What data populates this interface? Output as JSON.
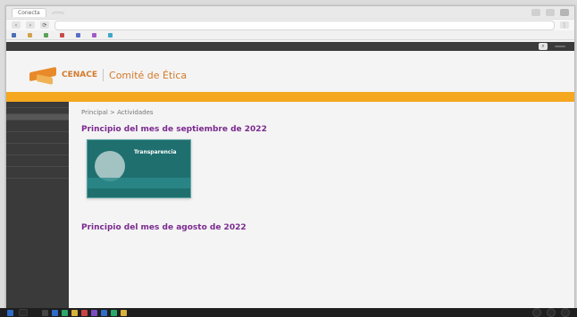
{
  "browser": {
    "tab_active": "Conecta",
    "tab_inactive": "",
    "address": "",
    "bookmarks": [
      "",
      "",
      "",
      "",
      "",
      "",
      ""
    ]
  },
  "site": {
    "topbar_right": "",
    "utility_left": "",
    "utility_right": "",
    "brand": "CENACE",
    "brand_sub": "Comité de Ética",
    "orange_menu": [
      "",
      "",
      "",
      "",
      ""
    ]
  },
  "sidenav": {
    "items": [
      "",
      "",
      ""
    ],
    "group_items": [
      "",
      "",
      "",
      "",
      ""
    ]
  },
  "main": {
    "breadcrumb": "Principal > Actividades",
    "intro": "",
    "section1_title": "Principio del mes de septiembre de 2022",
    "section1_text": "",
    "section1_highlight": "",
    "card_title": "Transparencia",
    "card_caption": "",
    "meta_left": "",
    "meta_right": "",
    "section2_title": "Principio del mes de agosto de 2022",
    "section2_text": "",
    "section2_highlight": ""
  },
  "taskbar": {
    "search_placeholder": ""
  },
  "colors": {
    "orange_bar": "#f4a71f",
    "purple_heading": "#7b2a8f",
    "sidebar": "#3a3a3a",
    "card_teal": "#1f6f6f"
  }
}
